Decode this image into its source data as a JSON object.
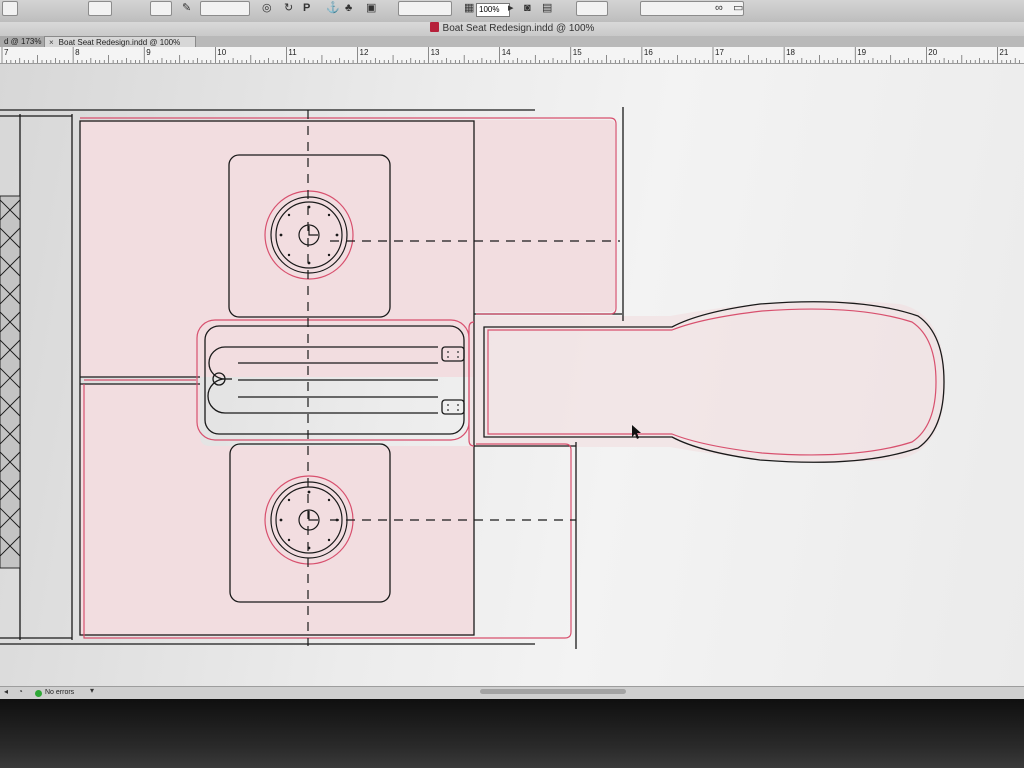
{
  "window": {
    "title": "Boat Seat Redesign.indd @ 100%"
  },
  "tabs": [
    {
      "label": "d @ 173%",
      "active": false
    },
    {
      "label": "Boat Seat Redesign.indd @ 100%",
      "active": true
    }
  ],
  "tab_close_glyph": "×",
  "control_bar": {
    "zoom": "100%"
  },
  "ruler": {
    "labels": [
      "7",
      "8",
      "9",
      "10",
      "11",
      "12",
      "13",
      "14",
      "15",
      "16",
      "17",
      "18",
      "19",
      "20",
      "21"
    ]
  },
  "status": {
    "preflight": "No errors"
  },
  "colors": {
    "bleed_line": "#d8506e",
    "frame_line": "#1a1a1a",
    "page_tint": "#f2dde0"
  }
}
